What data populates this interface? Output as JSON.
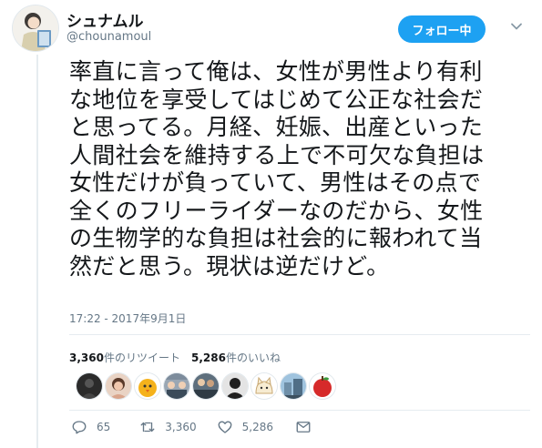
{
  "user": {
    "display_name": "シュナムル",
    "handle": "@chounamoul"
  },
  "follow_button": {
    "label": "フォロー中"
  },
  "tweet": {
    "text": "率直に言って俺は、女性が男性より有利\nな地位を享受してはじめて公正な社会だ\nと思ってる。月経、妊娠、出産といった\n人間社会を維持する上で不可欠な負担は\n女性だけが負っていて、男性はその点で\n全くのフリーライダーなのだから、女性\nの生物学的な負担は社会的に報われて当\n然だと思う。現状は逆だけど。",
    "timestamp": "17:22 - 2017年9月1日"
  },
  "stats": {
    "retweet_count": "3,360",
    "retweet_label": "件のリツイート",
    "like_count": "5,286",
    "like_label": "件のいいね"
  },
  "likers": [
    {
      "icon": "avatar-dark",
      "color": "#2b2b2b"
    },
    {
      "icon": "avatar-woman",
      "color": "#d9a58c"
    },
    {
      "icon": "avatar-chick",
      "color": "#f5b21b"
    },
    {
      "icon": "avatar-group",
      "color": "#7d8c9c"
    },
    {
      "icon": "avatar-scene",
      "color": "#5e6f7d"
    },
    {
      "icon": "avatar-silhouette",
      "color": "#1f1f1f"
    },
    {
      "icon": "avatar-cat",
      "color": "#f7ecd2"
    },
    {
      "icon": "avatar-building",
      "color": "#6f8fa8"
    },
    {
      "icon": "avatar-apple",
      "color": "#d62a2a"
    }
  ],
  "actions": {
    "reply_count": "65",
    "retweet_count": "3,360",
    "like_count": "5,286"
  },
  "colors": {
    "accent": "#1da1f2",
    "secondary_text": "#657786",
    "divider": "#e6ecf0"
  }
}
